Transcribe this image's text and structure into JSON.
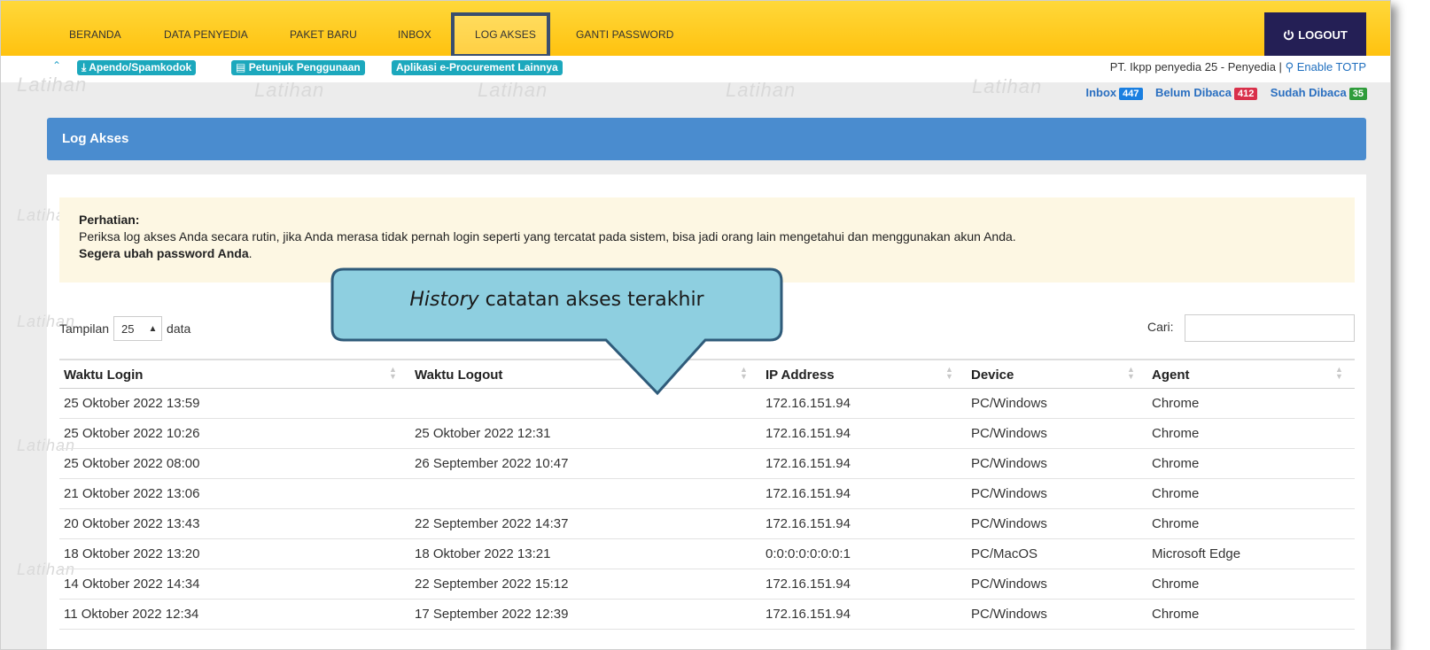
{
  "nav": {
    "items": [
      "BERANDA",
      "DATA PENYEDIA",
      "PAKET BARU",
      "INBOX",
      "LOG AKSES",
      "GANTI PASSWORD"
    ],
    "logout_label": "LOGOUT"
  },
  "subbar": {
    "links": [
      "Apendo/Spamkodok",
      "Petunjuk Penggunaan",
      "Aplikasi e-Procurement Lainnya"
    ],
    "user_text": "PT. Ikpp penyedia 25 - Penyedia |",
    "totp_label": "Enable TOTP"
  },
  "watermark": "Latihan",
  "inbox": {
    "inbox_label": "Inbox",
    "inbox_count": "447",
    "unread_label": "Belum Dibaca",
    "unread_count": "412",
    "read_label": "Sudah Dibaca",
    "read_count": "35"
  },
  "panel": {
    "title": "Log Akses"
  },
  "alert": {
    "heading": "Perhatian:",
    "body": "Periksa log akses Anda secara rutin, jika Anda merasa tidak pernah login seperti yang tercatat pada sistem, bisa jadi orang lain mengetahui dan menggunakan akun Anda.",
    "strong": "Segera ubah password Anda",
    "period": "."
  },
  "controls": {
    "show_label": "Tampilan",
    "show_value": "25",
    "show_suffix": "data",
    "search_label": "Cari:"
  },
  "callout": {
    "italic": "History",
    "text": " catatan akses terakhir"
  },
  "table": {
    "headers": [
      "Waktu Login",
      "Waktu Logout",
      "IP Address",
      "Device",
      "Agent"
    ],
    "rows": [
      [
        "25 Oktober 2022 13:59",
        "",
        "172.16.151.94",
        "PC/Windows",
        "Chrome"
      ],
      [
        "25 Oktober 2022 10:26",
        "25 Oktober 2022 12:31",
        "172.16.151.94",
        "PC/Windows",
        "Chrome"
      ],
      [
        "25 Oktober 2022 08:00",
        "26 September 2022 10:47",
        "172.16.151.94",
        "PC/Windows",
        "Chrome"
      ],
      [
        "21 Oktober 2022 13:06",
        "",
        "172.16.151.94",
        "PC/Windows",
        "Chrome"
      ],
      [
        "20 Oktober 2022 13:43",
        "22 September 2022 14:37",
        "172.16.151.94",
        "PC/Windows",
        "Chrome"
      ],
      [
        "18 Oktober 2022 13:20",
        "18 Oktober 2022 13:21",
        "0:0:0:0:0:0:0:1",
        "PC/MacOS",
        "Microsoft Edge"
      ],
      [
        "14 Oktober 2022 14:34",
        "22 September 2022 15:12",
        "172.16.151.94",
        "PC/Windows",
        "Chrome"
      ],
      [
        "11 Oktober 2022 12:34",
        "17 September 2022 12:39",
        "172.16.151.94",
        "PC/Windows",
        "Chrome"
      ]
    ]
  }
}
